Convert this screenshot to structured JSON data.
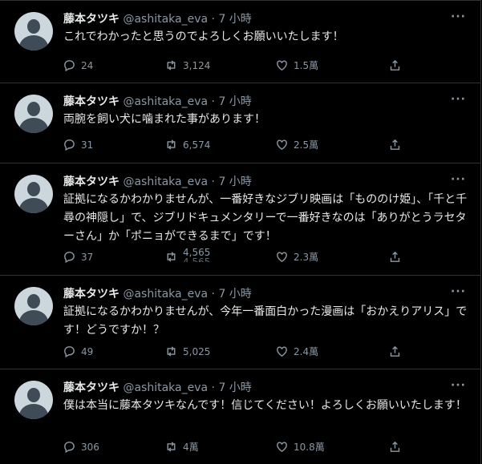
{
  "tweets": [
    {
      "name": "藤本タツキ",
      "handle": "@ashitaka_eva",
      "separator": "·",
      "time": "7 小時",
      "more": "···",
      "text": "これでわかったと思うのでよろしくお願いいたします！",
      "replies": "24",
      "retweets": "3,124",
      "likes": "1.5萬"
    },
    {
      "name": "藤本タツキ",
      "handle": "@ashitaka_eva",
      "separator": "·",
      "time": "7 小時",
      "more": "···",
      "text": "両腕を飼い犬に噛まれた事があります！",
      "replies": "31",
      "retweets": "6,574",
      "likes": "2.5萬"
    },
    {
      "name": "藤本タツキ",
      "handle": "@ashitaka_eva",
      "separator": "·",
      "time": "7 小時",
      "more": "···",
      "text": "証拠になるかわかりませんが、一番好きなジブリ映画は「もののけ姫」、「千と千尋の神隠し」で、ジブリドキュメンタリーで一番好きなのは「ありがとうラセターさん」か「ポニョができるまで」です！",
      "replies": "37",
      "retweets": "4,565",
      "likes": "2.3萬"
    },
    {
      "name": "藤本タツキ",
      "handle": "@ashitaka_eva",
      "separator": "·",
      "time": "7 小時",
      "more": "···",
      "text": "証拠になるかわかりませんが、今年一番面白かった漫画は「おかえりアリス」です！どうですか！？",
      "replies": "49",
      "retweets": "5,025",
      "likes": "2.4萬"
    },
    {
      "name": "藤本タツキ",
      "handle": "@ashitaka_eva",
      "separator": "·",
      "time": "7 小時",
      "more": "···",
      "text": "僕は本当に藤本タツキなんです！信じてください！よろしくお願いいたします！",
      "replies": "306",
      "retweets": "4萬",
      "likes": "10.8萬"
    }
  ],
  "icons": {
    "reply": "reply-icon",
    "retweet": "retweet-icon",
    "like": "heart-icon",
    "share": "share-icon"
  },
  "colors": {
    "background": "#000000",
    "text": "#e7e9ea",
    "muted": "#8b98a5",
    "divider": "#2f3336"
  }
}
